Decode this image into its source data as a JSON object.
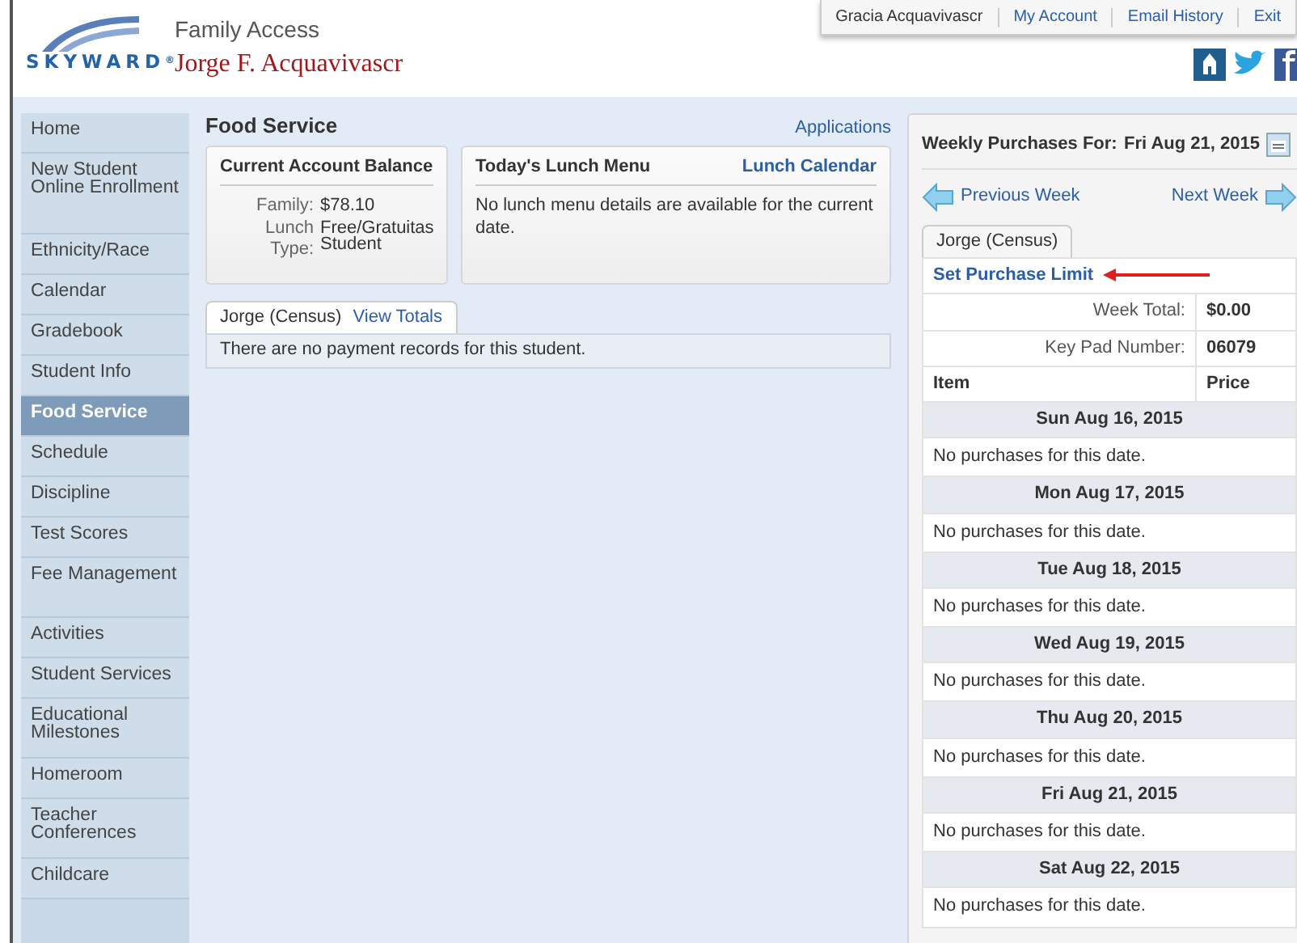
{
  "header": {
    "logo_text": "SKYWARD$^{®}$",
    "app_title": "Family Access",
    "student_name": "Jorge F. Acquavivascr",
    "top_links": [
      {
        "label": "Gracia Acquavivascr",
        "kind": "user"
      },
      {
        "label": "My Account",
        "kind": "link"
      },
      {
        "label": "Email History",
        "kind": "link"
      },
      {
        "label": "Exit",
        "kind": "link"
      }
    ]
  },
  "sidebar": {
    "items": [
      {
        "label": "Home",
        "selected": false
      },
      {
        "label": "New Student Online Enrollment",
        "selected": false
      },
      {
        "label": "Ethnicity/Race",
        "selected": false
      },
      {
        "label": "Calendar",
        "selected": false
      },
      {
        "label": "Gradebook",
        "selected": false
      },
      {
        "label": "Student Info",
        "selected": false
      },
      {
        "label": "Food Service",
        "selected": true
      },
      {
        "label": "Schedule",
        "selected": false
      },
      {
        "label": "Discipline",
        "selected": false
      },
      {
        "label": "Test Scores",
        "selected": false
      },
      {
        "label": "Fee Management",
        "selected": false
      },
      {
        "label": "Activities",
        "selected": false
      },
      {
        "label": "Student Services",
        "selected": false
      },
      {
        "label": "Educational Milestones",
        "selected": false
      },
      {
        "label": "Homeroom",
        "selected": false
      },
      {
        "label": "Teacher Conferences",
        "selected": false
      },
      {
        "label": "Childcare",
        "selected": false
      }
    ]
  },
  "main": {
    "title": "Food Service",
    "applications_link": "Applications",
    "balance_card": {
      "title": "Current Account Balance",
      "rows": [
        {
          "label": "Family:",
          "value": "$78.10"
        },
        {
          "label": "Lunch Type:",
          "value": "Free/Gratuitas Student"
        }
      ]
    },
    "lunch_card": {
      "title": "Today's Lunch Menu",
      "link": "Lunch Calendar",
      "message": "No lunch menu details are available for the current date."
    },
    "tab": {
      "label": "Jorge (Census)",
      "link": "View Totals"
    },
    "message": "There are no payment records for this student."
  },
  "weekly": {
    "label": "Weekly Purchases For:",
    "date": "Fri Aug 21, 2015",
    "previous": "Previous Week",
    "next": "Next Week",
    "tab": "Jorge (Census)",
    "limit_link": "Set Purchase Limit",
    "summary": [
      {
        "label": "Week Total:",
        "value": "$0.00"
      },
      {
        "label": "Key Pad Number:",
        "value": "06079"
      }
    ],
    "columns": [
      "Item",
      "Price"
    ],
    "days": [
      {
        "date": "Sun Aug 16, 2015",
        "message": "No purchases for this date."
      },
      {
        "date": "Mon Aug 17, 2015",
        "message": "No purchases for this date."
      },
      {
        "date": "Tue Aug 18, 2015",
        "message": "No purchases for this date."
      },
      {
        "date": "Wed Aug 19, 2015",
        "message": "No purchases for this date."
      },
      {
        "date": "Thu Aug 20, 2015",
        "message": "No purchases for this date."
      },
      {
        "date": "Fri Aug 21, 2015",
        "message": "No purchases for this date."
      },
      {
        "date": "Sat Aug 22, 2015",
        "message": "No purchases for this date."
      }
    ]
  }
}
